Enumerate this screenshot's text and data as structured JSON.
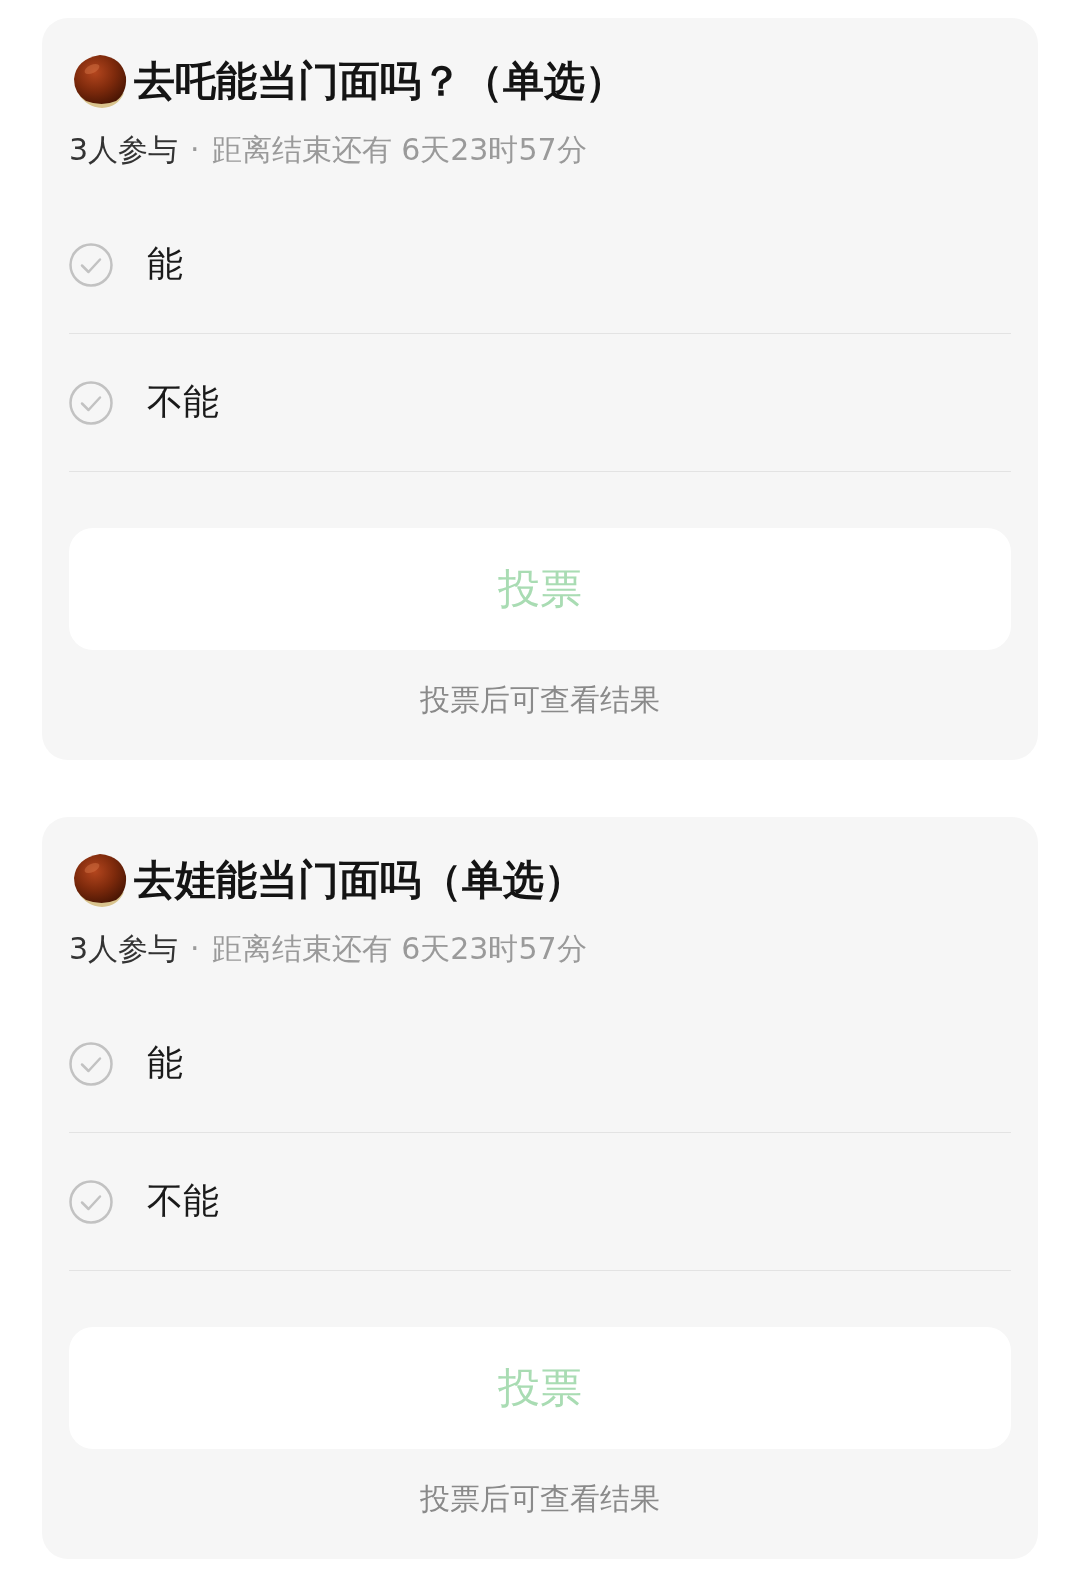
{
  "polls": [
    {
      "title": "去吒能当门面吗？（单选）",
      "participants": "3人参与",
      "separator": "·",
      "deadline": "距离结束还有 6天23时57分",
      "options": [
        {
          "label": "能",
          "selected": false
        },
        {
          "label": "不能",
          "selected": false
        }
      ],
      "vote_button": {
        "label": "投票",
        "disabled": true
      },
      "hint": "投票后可查看结果"
    },
    {
      "title": "去娃能当门面吗（单选）",
      "participants": "3人参与",
      "separator": "·",
      "deadline": "距离结束还有 6天23时57分",
      "options": [
        {
          "label": "能",
          "selected": false
        },
        {
          "label": "不能",
          "selected": false
        }
      ],
      "vote_button": {
        "label": "投票",
        "disabled": true
      },
      "hint": "投票后可查看结果"
    }
  ]
}
